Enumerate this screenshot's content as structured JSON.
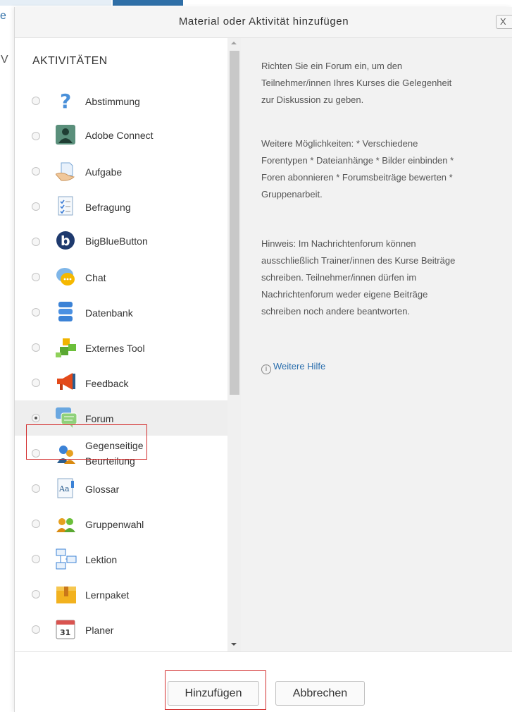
{
  "background": {
    "left_letter": "e",
    "left_letter2": "V"
  },
  "dialog": {
    "title": "Material oder Aktivität hinzufügen",
    "close_label": "X"
  },
  "activities": {
    "section_title": "AKTIVITÄTEN",
    "items": [
      {
        "label": "Abstimmung",
        "icon": "question-icon",
        "selected": false
      },
      {
        "label": "Adobe Connect",
        "icon": "adobe-connect-icon",
        "selected": false
      },
      {
        "label": "Aufgabe",
        "icon": "assignment-icon",
        "selected": false
      },
      {
        "label": "Befragung",
        "icon": "survey-icon",
        "selected": false
      },
      {
        "label": "BigBlueButton",
        "icon": "bigbluebutton-icon",
        "selected": false
      },
      {
        "label": "Chat",
        "icon": "chat-icon",
        "selected": false
      },
      {
        "label": "Datenbank",
        "icon": "database-icon",
        "selected": false
      },
      {
        "label": "Externes Tool",
        "icon": "puzzle-icon",
        "selected": false
      },
      {
        "label": "Feedback",
        "icon": "megaphone-icon",
        "selected": false
      },
      {
        "label": "Forum",
        "icon": "forum-icon",
        "selected": true
      },
      {
        "label_line1": "Gegenseitige",
        "label_line2": "Beurteilung",
        "icon": "peer-review-icon",
        "selected": false
      },
      {
        "label": "Glossar",
        "icon": "glossary-icon",
        "selected": false
      },
      {
        "label": "Gruppenwahl",
        "icon": "group-choice-icon",
        "selected": false
      },
      {
        "label": "Lektion",
        "icon": "lesson-icon",
        "selected": false
      },
      {
        "label": "Lernpaket",
        "icon": "package-icon",
        "selected": false
      },
      {
        "label": "Planer",
        "icon": "calendar-icon",
        "calendar_day": "31",
        "selected": false
      }
    ]
  },
  "help": {
    "paragraph1_lines": [
      "Richten Sie ein Forum ein, um den",
      "Teilnehmer/innen Ihres Kurses die Gelegenheit",
      "zur Diskussion zu geben."
    ],
    "paragraph2_lines": [
      "Weitere Möglichkeiten: * Verschiedene",
      "Forentypen * Dateianhänge * Bilder einbinden *",
      "Foren abonnieren * Forumsbeiträge bewerten *",
      "Gruppenarbeit."
    ],
    "paragraph3_lines": [
      "Hinweis: Im Nachrichtenforum können",
      "ausschließlich Trainer/innen des Kurse Beiträge",
      "schreiben. Teilnehmer/innen dürfen im",
      "Nachrichtenforum weder eigene Beiträge",
      "schreiben noch andere beantworten."
    ],
    "more_help_link": "Weitere Hilfe",
    "info_glyph": "i"
  },
  "footer": {
    "add_button": "Hinzufügen",
    "cancel_button": "Abbrechen"
  },
  "colors": {
    "highlight_border": "#d32f2f",
    "link": "#2a6ead",
    "help_background": "#f2f2f2"
  }
}
